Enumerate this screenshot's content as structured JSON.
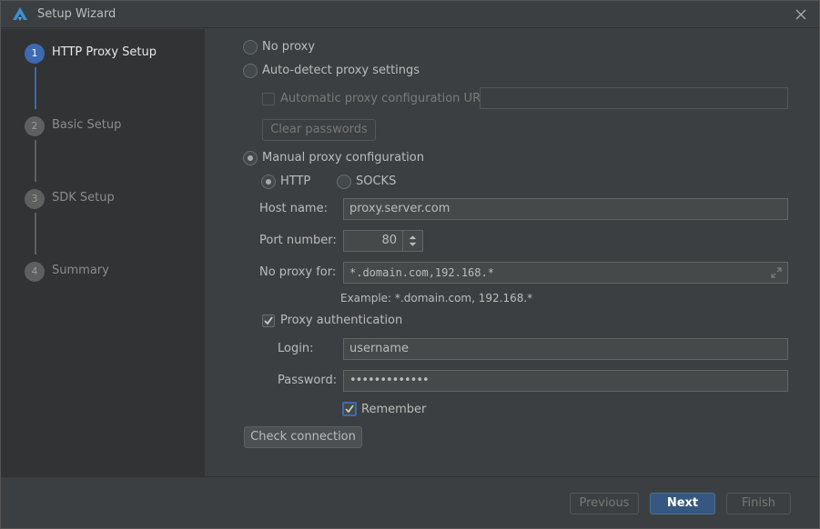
{
  "window": {
    "title": "Setup Wizard"
  },
  "icons": {
    "logo": "app-logo-icon",
    "close": "close-icon",
    "expand": "expand-icon",
    "spinner": "spinner-arrows-icon"
  },
  "colors": {
    "accent": "#3d6ab1",
    "primary_button": "#365880"
  },
  "steps": [
    {
      "number": "1",
      "label": "HTTP Proxy Setup",
      "active": true
    },
    {
      "number": "2",
      "label": "Basic Setup",
      "active": false
    },
    {
      "number": "3",
      "label": "SDK Setup",
      "active": false
    },
    {
      "number": "4",
      "label": "Summary",
      "active": false
    }
  ],
  "proxy": {
    "no_proxy_label": "No proxy",
    "auto_detect_label": "Auto-detect proxy settings",
    "auto_config_url_label": "Automatic proxy configuration URL:",
    "auto_config_url_value": "",
    "clear_passwords_label": "Clear passwords",
    "manual_label": "Manual proxy configuration",
    "selected_mode": "manual",
    "http_label": "HTTP",
    "socks_label": "SOCKS",
    "selected_protocol": "HTTP",
    "host_label": "Host name:",
    "host_value": "proxy.server.com",
    "port_label": "Port number:",
    "port_value": "80",
    "no_proxy_for_label": "No proxy for:",
    "no_proxy_for_value": "*.domain.com,192.168.*",
    "example_text": "Example: *.domain.com, 192.168.*",
    "auth_label": "Proxy authentication",
    "auth_checked": true,
    "login_label": "Login:",
    "login_value": "username",
    "password_label": "Password:",
    "password_value": "•••••••••••••",
    "remember_label": "Remember",
    "remember_checked": true,
    "check_connection_label": "Check connection"
  },
  "footer": {
    "previous_label": "Previous",
    "next_label": "Next",
    "finish_label": "Finish"
  }
}
